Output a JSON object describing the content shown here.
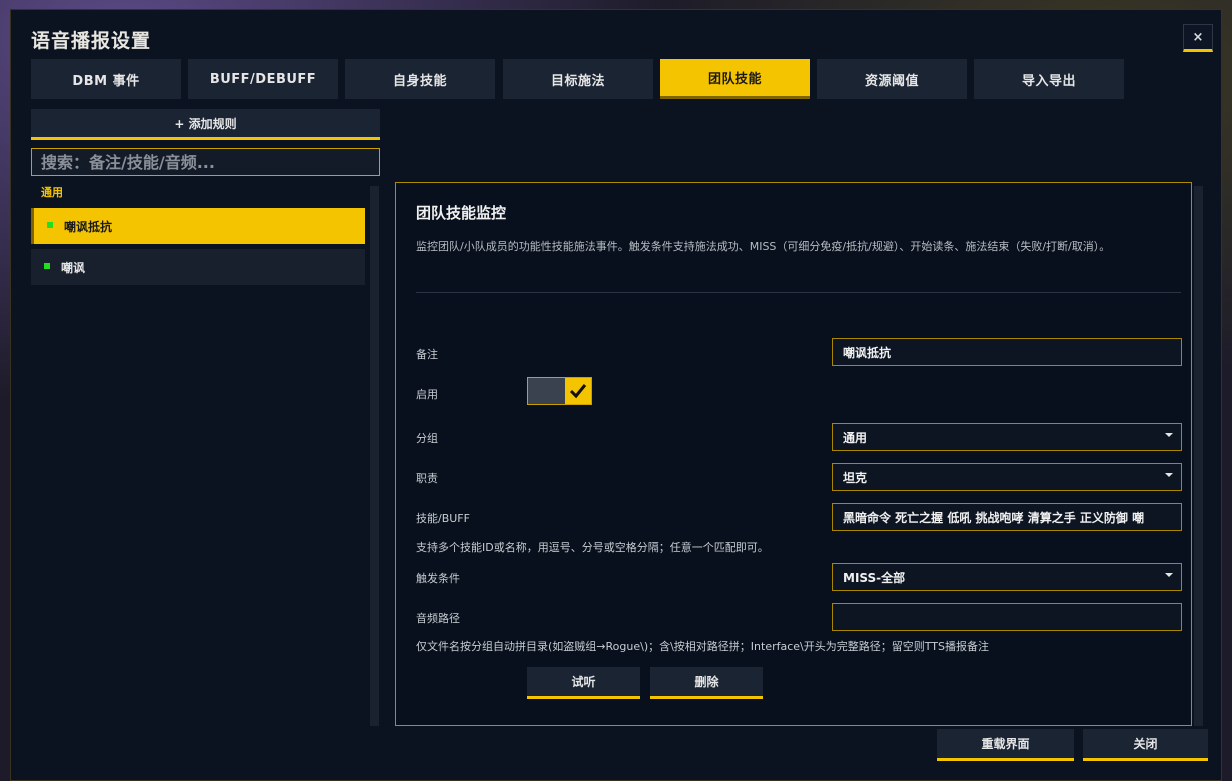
{
  "window": {
    "title": "语音播报设置",
    "close_label": "×"
  },
  "tabs": [
    {
      "label": "DBM 事件"
    },
    {
      "label": "BUFF/DEBUFF"
    },
    {
      "label": "自身技能"
    },
    {
      "label": "目标施法"
    },
    {
      "label": "团队技能",
      "active": true
    },
    {
      "label": "资源阈值"
    },
    {
      "label": "导入导出"
    }
  ],
  "sidebar": {
    "add_rule_label": "+ 添加规则",
    "search_placeholder": "搜索：备注/技能/音频...",
    "group_label": "通用",
    "items": [
      {
        "label": "嘲讽抵抗",
        "selected": true,
        "status_color": "#22dd22"
      },
      {
        "label": "嘲讽",
        "selected": false,
        "status_color": "#22dd22"
      }
    ]
  },
  "panel": {
    "title": "团队技能监控",
    "description": "监控团队/小队成员的功能性技能施法事件。触发条件支持施法成功、MISS（可细分免疫/抵抗/规避）、开始读条、施法结束（失败/打断/取消）。",
    "fields": {
      "note": {
        "label": "备注",
        "value": "嘲讽抵抗"
      },
      "enabled": {
        "label": "启用",
        "checked": true
      },
      "group": {
        "label": "分组",
        "value": "通用"
      },
      "role": {
        "label": "职责",
        "value": "坦克"
      },
      "spell": {
        "label": "技能/BUFF",
        "value": "黑暗命令 死亡之握 低吼 挑战咆哮 清算之手 正义防御 嘲"
      },
      "spell_hint": "支持多个技能ID或名称，用逗号、分号或空格分隔；任意一个匹配即可。",
      "trigger": {
        "label": "触发条件",
        "value": "MISS-全部"
      },
      "audio": {
        "label": "音频路径",
        "value": ""
      },
      "audio_hint": "仅文件名按分组自动拼目录(如盗贼组→Rogue\\)；含\\按相对路径拼；Interface\\开头为完整路径；留空则TTS播报备注"
    },
    "buttons": {
      "preview": "试听",
      "delete": "删除"
    }
  },
  "footer": {
    "reload_label": "重载界面",
    "close_label": "关闭"
  },
  "colors": {
    "accent": "#f5c400",
    "bg": "#0b1220",
    "status_green": "#22dd22"
  }
}
